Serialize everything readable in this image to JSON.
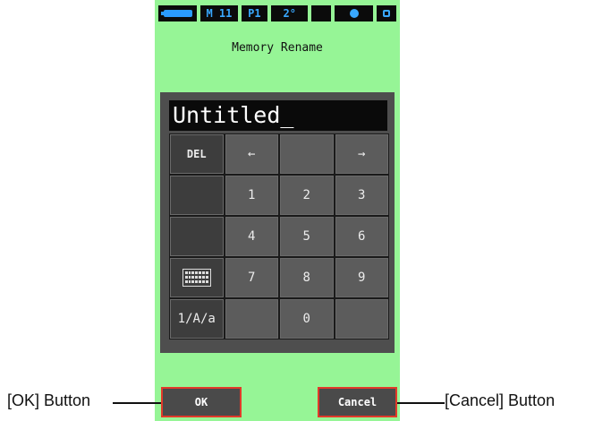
{
  "status_bar": {
    "cells": [
      "M 11",
      "P1",
      "2°"
    ]
  },
  "screen_title": "Memory Rename",
  "name_field": {
    "value": "Untitled_"
  },
  "keypad": {
    "rows": [
      [
        "DEL",
        "←",
        "",
        "→"
      ],
      [
        "",
        "1",
        "2",
        "3"
      ],
      [
        "",
        "4",
        "5",
        "6"
      ],
      [
        "keyboard-icon",
        "7",
        "8",
        "9"
      ],
      [
        "1/A/a",
        "",
        "0",
        ""
      ]
    ]
  },
  "buttons": {
    "ok": "OK",
    "cancel": "Cancel"
  },
  "callouts": {
    "ok": "[OK] Button",
    "cancel": "[Cancel] Button"
  },
  "colors": {
    "screen_bg": "#96f596",
    "highlight": "#e23a2a",
    "status_text": "#39a8ff"
  }
}
